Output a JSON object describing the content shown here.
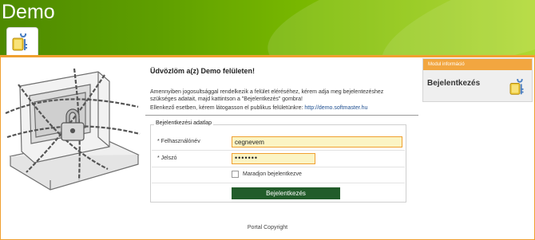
{
  "app": {
    "title": "Demo"
  },
  "nav": {
    "home_tab_icon": "lock-key-icon"
  },
  "content": {
    "welcome_title": "Üdvözlöm a(z) Demo felületen!",
    "intro_text": "Amennyiben jogosultsággal rendelkezik a felület eléréséhez, kérem adja meg bejelentezéshez szükséges adatait, majd kattintson a \"Bejelentkezés\" gombra!",
    "trouble_text": "Ellenkező esetben, kérem látogasson el publikus felületünkre:",
    "trouble_link": "http://demo.softmaster.hu"
  },
  "login": {
    "legend": "Bejelentkezési adatlap",
    "username_label": "* Felhasználónév",
    "username_value": "cegnevem",
    "password_label": "* Jelszó",
    "password_value": "•••••••",
    "remember_label": "Maradjon bejelentkezve",
    "remember_checked": false,
    "submit_label": "Bejelentkezés"
  },
  "module": {
    "header": "Modul információ",
    "title": "Bejelentkezés",
    "icon": "lock-key-icon"
  },
  "footer": {
    "copyright": "Portal Copyright"
  },
  "colors": {
    "header_green": "#5f9f00",
    "accent_orange": "#f0a030",
    "input_fill": "#fbf4c4",
    "button_green": "#225c2a",
    "link_blue": "#1f4f90"
  }
}
